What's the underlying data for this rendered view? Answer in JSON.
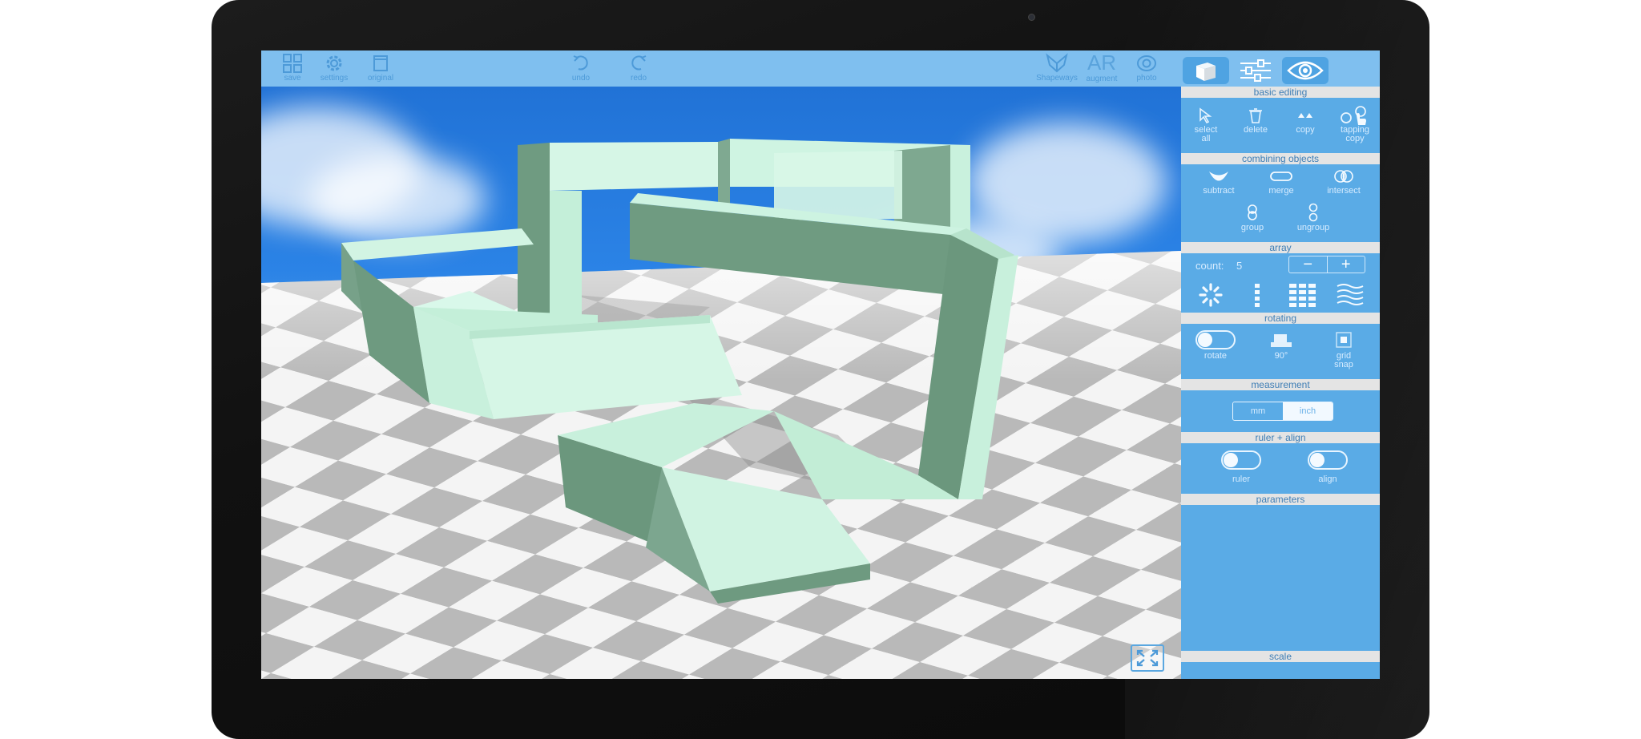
{
  "toolbar": {
    "left": [
      {
        "label": "save",
        "icon": "grid-icon"
      },
      {
        "label": "settings",
        "icon": "gear-icon"
      },
      {
        "label": "original",
        "icon": "document-icon"
      }
    ],
    "center": [
      {
        "label": "undo",
        "icon": "undo-icon"
      },
      {
        "label": "redo",
        "icon": "redo-icon"
      }
    ],
    "right": [
      {
        "label": "Shapeways",
        "icon": "shapeways-icon"
      },
      {
        "label": "augment",
        "icon_text": "AR"
      },
      {
        "label": "photo",
        "icon": "photo-icon"
      }
    ]
  },
  "panel": {
    "tabs": [
      {
        "name": "objects",
        "icon": "cube-icon",
        "active": false
      },
      {
        "name": "adjust",
        "icon": "sliders-icon",
        "active": false
      },
      {
        "name": "view",
        "icon": "eye-icon",
        "active": true
      }
    ],
    "sections": {
      "basic_editing": "basic editing",
      "combining_objects": "combining objects",
      "array": "array",
      "rotating": "rotating",
      "measurement": "measurement",
      "ruler_align": "ruler + align",
      "parameters": "parameters",
      "scale": "scale"
    },
    "basic_editing": {
      "select_all": "select all",
      "delete": "delete",
      "copy": "copy",
      "tapping_copy": "tapping copy"
    },
    "combining": {
      "subtract": "subtract",
      "merge": "merge",
      "intersect": "intersect",
      "group": "group",
      "ungroup": "ungroup"
    },
    "array": {
      "count_label": "count:",
      "count_value": "5",
      "minus": "−",
      "plus": "+"
    },
    "rotating": {
      "rotate": "rotate",
      "angle": "90°",
      "grid_snap": "grid snap"
    },
    "measurement": {
      "mm": "mm",
      "inch": "inch",
      "selected": "inch"
    },
    "ruler_align": {
      "ruler": "ruler",
      "align": "align"
    }
  },
  "colors": {
    "toolbar_bg": "#7fbfef",
    "panel_bg": "#5aabe6",
    "object_light": "#c8f0dc",
    "object_dark": "#6e9a80"
  }
}
